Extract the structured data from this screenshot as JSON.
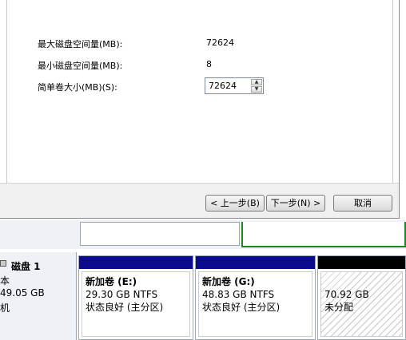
{
  "dialog": {
    "rows": [
      {
        "label": "最大磁盘空间量(MB):",
        "value": "72624"
      },
      {
        "label": "最小磁盘空间量(MB):",
        "value": "8"
      },
      {
        "label": "简单卷大小(MB)(S):",
        "value": "72624"
      }
    ],
    "buttons": {
      "back": "< 上一步(B)",
      "next": "下一步(N) >",
      "cancel": "取消"
    }
  },
  "disk": {
    "name": "磁盘 1",
    "type": "本",
    "size": "49.05 GB",
    "status": "机"
  },
  "partitions": [
    {
      "title": "新加卷  (E:)",
      "size": "29.30 GB NTFS",
      "status": "状态良好 (主分区)"
    },
    {
      "title": "新加卷  (G:)",
      "size": "48.83 GB NTFS",
      "status": "状态良好 (主分区)"
    }
  ],
  "unallocated": {
    "size": "70.92 GB",
    "status": "未分配"
  },
  "colors": {
    "primary_partition": "#0a0a8a",
    "unallocated": "#000000",
    "selected_volume": "#1a8a1a"
  }
}
